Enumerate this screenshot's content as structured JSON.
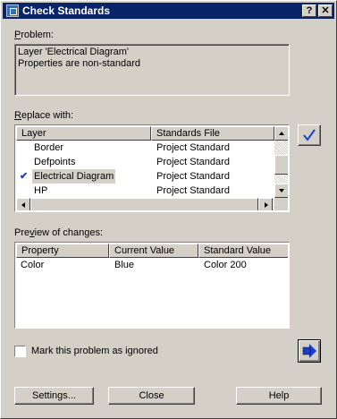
{
  "window": {
    "title": "Check Standards"
  },
  "titlebar": {
    "help_glyph": "?",
    "close_glyph": "✕"
  },
  "problem": {
    "label": "Problem:",
    "line1": "Layer 'Electrical Diagram'",
    "line2": "Properties are non-standard"
  },
  "replace": {
    "label": "Replace with:",
    "columns": [
      "Layer",
      "Standards File"
    ],
    "rows": [
      {
        "layer": "Border",
        "file": "Project Standard",
        "checked": false
      },
      {
        "layer": "Defpoints",
        "file": "Project Standard",
        "checked": false
      },
      {
        "layer": "Electrical Diagram",
        "file": "Project Standard",
        "checked": true
      },
      {
        "layer": "HP",
        "file": "Project Standard",
        "checked": false
      }
    ],
    "check_mark": "✔",
    "fix_button_icon": "checkmark-icon"
  },
  "preview": {
    "label": "Preview of changes:",
    "columns": [
      "Property",
      "Current Value",
      "Standard Value"
    ],
    "rows": [
      {
        "property": "Color",
        "current": "Blue",
        "standard": "Color 200"
      }
    ]
  },
  "ignore": {
    "label": "Mark this problem as ignored",
    "checked": false
  },
  "next_button_icon": "next-arrow-icon",
  "buttons": {
    "settings": "Settings...",
    "close": "Close",
    "help": "Help"
  },
  "colors": {
    "titlebar": "#0a246a",
    "face": "#d4d0c8",
    "check_blue": "#1a3fd0"
  }
}
